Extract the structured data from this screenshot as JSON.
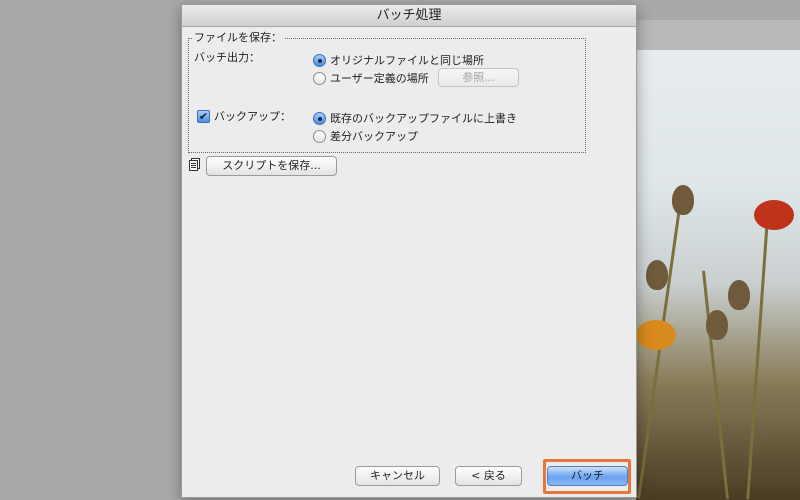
{
  "dialog": {
    "title": "バッチ処理",
    "save_group": {
      "title": "ファイルを保存：",
      "batch_output_label": "バッチ出力：",
      "output_options": [
        "オリジナルファイルと同じ場所",
        "ユーザー定義の場所"
      ],
      "output_selected": 0,
      "browse_label": "参照...",
      "backup_label": "バックアップ：",
      "backup_checked": true,
      "backup_options": [
        "既存のバックアップファイルに上書き",
        "差分バックアップ"
      ],
      "backup_selected": 0
    },
    "save_script_label": "スクリプトを保存...",
    "buttons": {
      "cancel": "キャンセル",
      "back": "< 戻る",
      "batch": "バッチ"
    }
  },
  "icons": {
    "document": "document-icon",
    "check": "check-icon"
  },
  "colors": {
    "accent": "#4a8fe2",
    "highlight": "#e8763a"
  }
}
